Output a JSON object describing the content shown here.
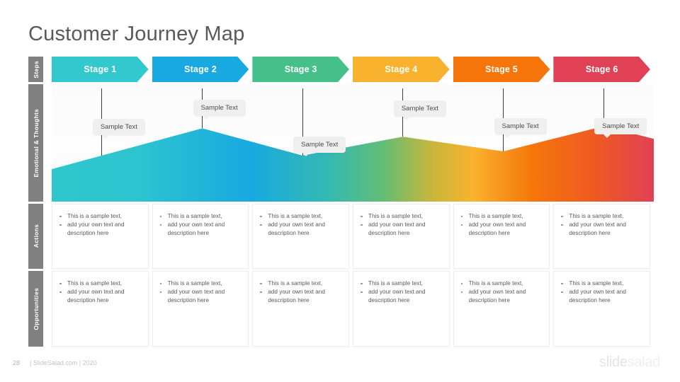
{
  "title": "Customer Journey Map",
  "rows": [
    {
      "label": "Steps"
    },
    {
      "label": "Emotional & Thoughts"
    },
    {
      "label": "Actions"
    },
    {
      "label": "Opportunities"
    }
  ],
  "stages": [
    {
      "label": "Stage 1",
      "color": "#33c7ce"
    },
    {
      "label": "Stage 2",
      "color": "#17a9e0"
    },
    {
      "label": "Stage 3",
      "color": "#45c08a"
    },
    {
      "label": "Stage 4",
      "color": "#f9b22d"
    },
    {
      "label": "Stage 5",
      "color": "#f5750a"
    },
    {
      "label": "Stage 6",
      "color": "#e04155"
    }
  ],
  "emotional": {
    "bubbles": [
      {
        "text": "Sample Text"
      },
      {
        "text": "Sample Text"
      },
      {
        "text": "Sample Text"
      },
      {
        "text": "Sample Text"
      },
      {
        "text": "Sample Text"
      },
      {
        "text": "Sample Text"
      }
    ]
  },
  "chart_data": {
    "type": "area",
    "title": "Emotional & Thoughts",
    "categories": [
      "Stage 1",
      "Stage 2",
      "Stage 3",
      "Stage 4",
      "Stage 5",
      "Stage 6"
    ],
    "values": [
      44,
      70,
      44,
      62,
      48,
      72
    ],
    "ylim": [
      0,
      100
    ],
    "grid": false,
    "legend": null,
    "annotations": [
      "Sample Text",
      "Sample Text",
      "Sample Text",
      "Sample Text",
      "Sample Text",
      "Sample Text"
    ],
    "gradient_stops": [
      "#2fc6cd",
      "#17a9e0",
      "#45c08a",
      "#f9b22d",
      "#f5750a",
      "#e04155"
    ]
  },
  "actions": {
    "cards": [
      {
        "bullets": [
          "This is a sample text,",
          "add your own text and description here"
        ]
      },
      {
        "bullets": [
          "This is a sample text,",
          "add your own text and description here"
        ]
      },
      {
        "bullets": [
          "This is a sample text,",
          "add your own text and description here"
        ]
      },
      {
        "bullets": [
          "This is a sample text,",
          "add your own text and description here"
        ]
      },
      {
        "bullets": [
          "This is a sample text,",
          "add your own text and description here"
        ]
      },
      {
        "bullets": [
          "This is a sample text,",
          "add your own text and description here"
        ]
      }
    ]
  },
  "opportunities": {
    "cards": [
      {
        "bullets": [
          "This is a sample text,",
          "add your own text and description here"
        ]
      },
      {
        "bullets": [
          "This is a sample text,",
          "add your own text and description here"
        ]
      },
      {
        "bullets": [
          "This is a sample text,",
          "add your own text and description here"
        ]
      },
      {
        "bullets": [
          "This is a sample text,",
          "add your own text and description here"
        ]
      },
      {
        "bullets": [
          "This is a sample text,",
          "add your own text and description here"
        ]
      },
      {
        "bullets": [
          "This is a sample text,",
          "add your own text and description here"
        ]
      }
    ]
  },
  "footer": {
    "page_number": "28",
    "credit": "| SlideSalad.com | 2020",
    "logo_part1": "slide",
    "logo_part2": "salad"
  }
}
